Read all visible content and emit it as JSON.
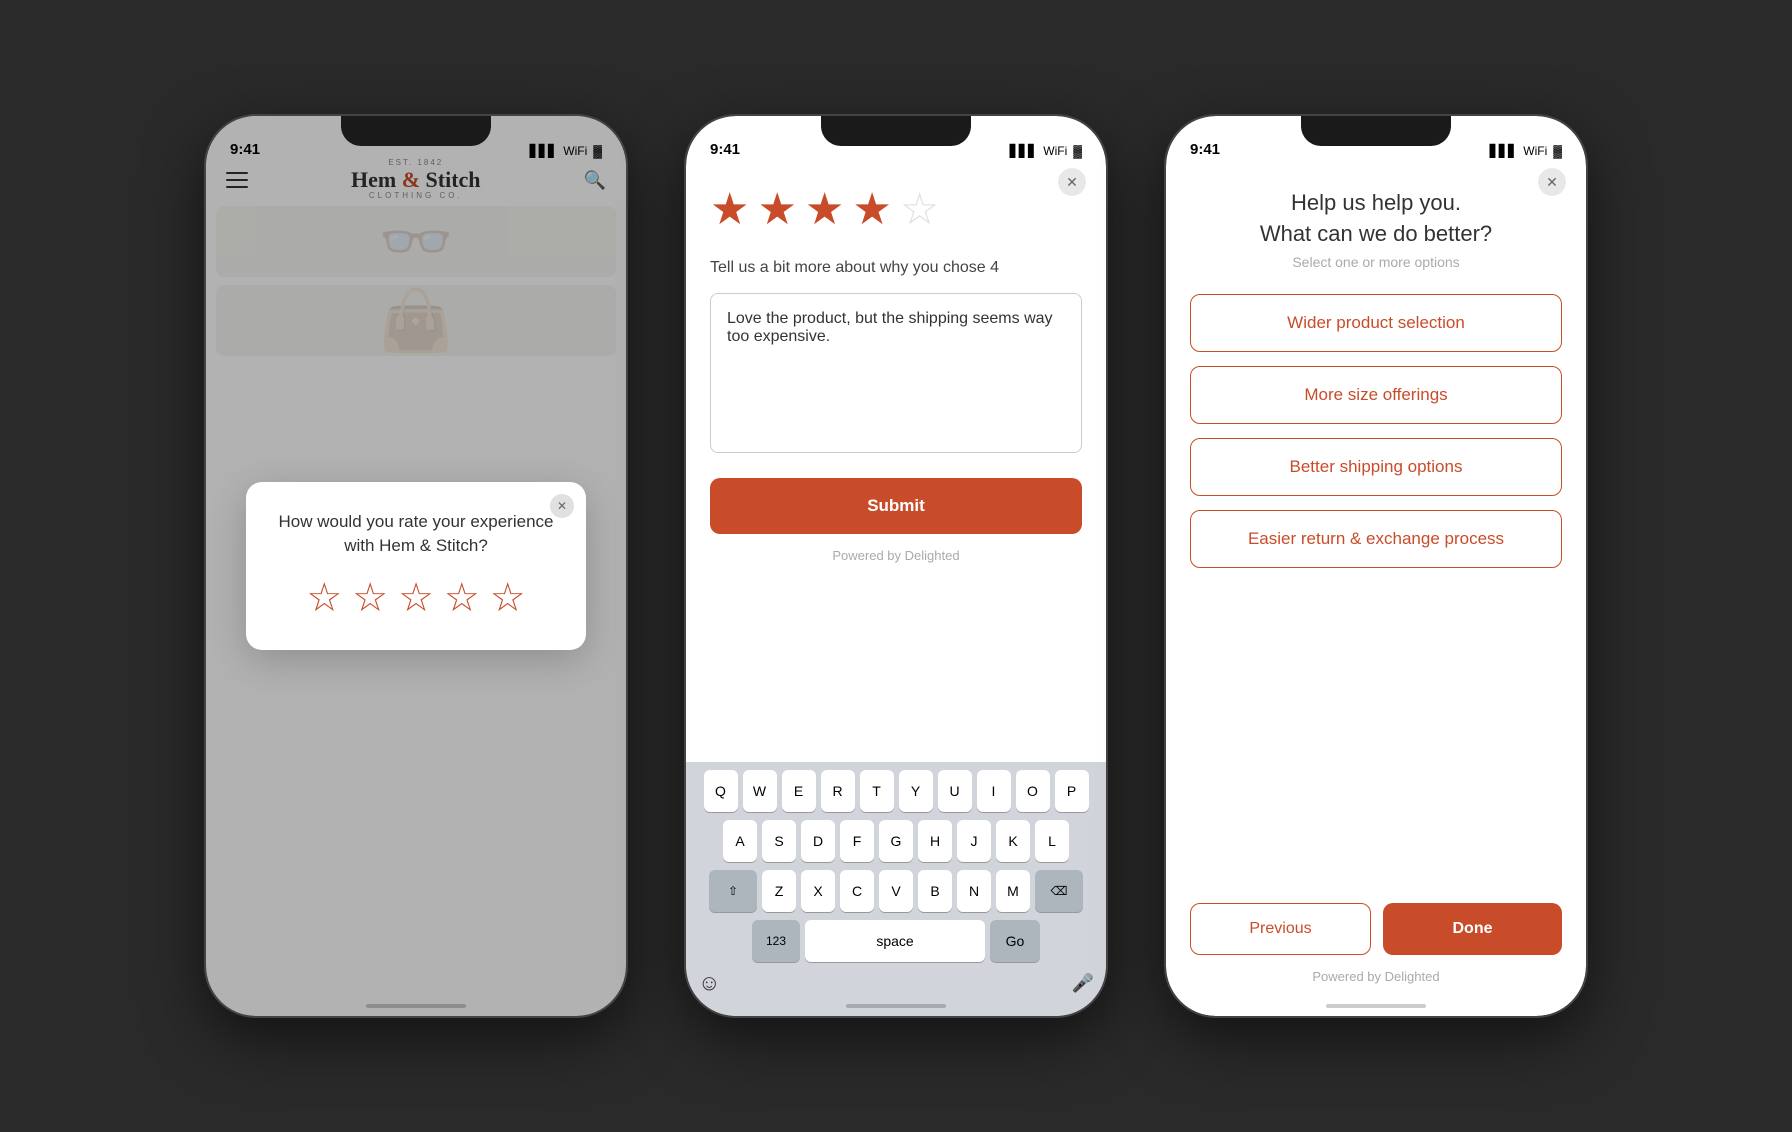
{
  "phone1": {
    "status": {
      "time": "9:41",
      "signal": "▋▋▋",
      "wifi": "WiFi",
      "battery": "🔋"
    },
    "brand": {
      "est": "EST. 1842",
      "name": "Hem & Stitch",
      "sub": "CLOTHING CO."
    },
    "modal": {
      "close_label": "✕",
      "title": "How would you rate your experience with Hem & Stitch?",
      "stars": [
        "☆",
        "☆",
        "☆",
        "☆",
        "☆"
      ]
    }
  },
  "phone2": {
    "status": {
      "time": "9:41"
    },
    "close_label": "✕",
    "stars_filled": 4,
    "stars_total": 5,
    "question": "Tell us a bit more about why you chose 4",
    "textarea_value": "Love the product, but the shipping seems way too expensive.",
    "submit_label": "Submit",
    "powered_by": "Powered by Delighted",
    "keyboard": {
      "row1": [
        "Q",
        "W",
        "E",
        "R",
        "T",
        "Y",
        "U",
        "I",
        "O",
        "P"
      ],
      "row2": [
        "A",
        "S",
        "D",
        "F",
        "G",
        "H",
        "J",
        "K",
        "L"
      ],
      "row3": [
        "Z",
        "X",
        "C",
        "V",
        "B",
        "N",
        "M"
      ],
      "num_label": "123",
      "space_label": "space",
      "go_label": "Go"
    }
  },
  "phone3": {
    "status": {
      "time": "9:41"
    },
    "close_label": "✕",
    "title_line1": "Help us help you.",
    "title_line2": "What can we do better?",
    "subtitle": "Select one or more options",
    "options": [
      "Wider product selection",
      "More size offerings",
      "Better shipping options",
      "Easier return & exchange process"
    ],
    "previous_label": "Previous",
    "done_label": "Done",
    "powered_by": "Powered by Delighted"
  }
}
